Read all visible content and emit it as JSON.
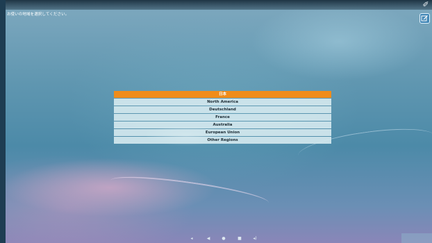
{
  "prompt": {
    "text": "お使いの地域を選択してください。"
  },
  "regions": [
    {
      "label": "日本",
      "selected": true
    },
    {
      "label": "North America",
      "selected": false
    },
    {
      "label": "Deutschland",
      "selected": false
    },
    {
      "label": "France",
      "selected": false
    },
    {
      "label": "Australia",
      "selected": false
    },
    {
      "label": "European Union",
      "selected": false
    },
    {
      "label": "Other Regions",
      "selected": false
    }
  ],
  "colors": {
    "selected_item": "#f08c1a",
    "item_background": "#d6eaf0"
  },
  "icons": {
    "top_right": "pen-tool-icon",
    "edit": "edit-icon",
    "nav": [
      "volume-down-icon",
      "back-icon",
      "home-icon",
      "recents-icon",
      "volume-up-icon"
    ]
  }
}
